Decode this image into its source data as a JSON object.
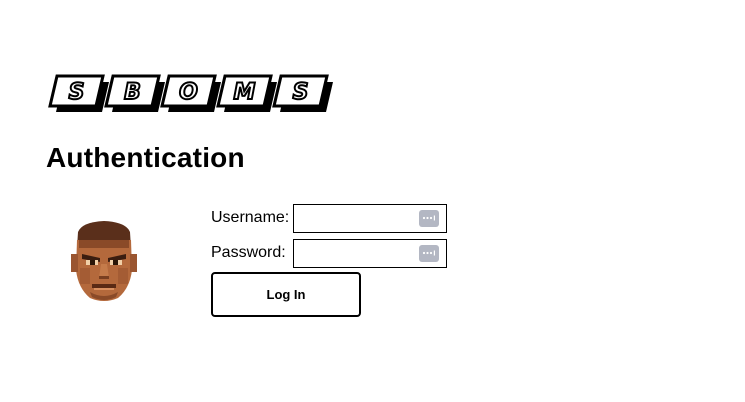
{
  "logo": {
    "letters": [
      "S",
      "B",
      "O",
      "M",
      "S"
    ],
    "icon": "sboms-logo"
  },
  "page": {
    "heading": "Authentication"
  },
  "avatar": {
    "icon": "doomguy-face-icon"
  },
  "form": {
    "username_label": "Username:",
    "username_value": "",
    "password_label": "Password:",
    "password_value": "",
    "autofill_icon": "password-manager-key-icon",
    "login_label": "Log In"
  },
  "colors": {
    "background": "#ffffff",
    "text": "#000000",
    "autofill_icon_bg": "#b3b7c3"
  }
}
